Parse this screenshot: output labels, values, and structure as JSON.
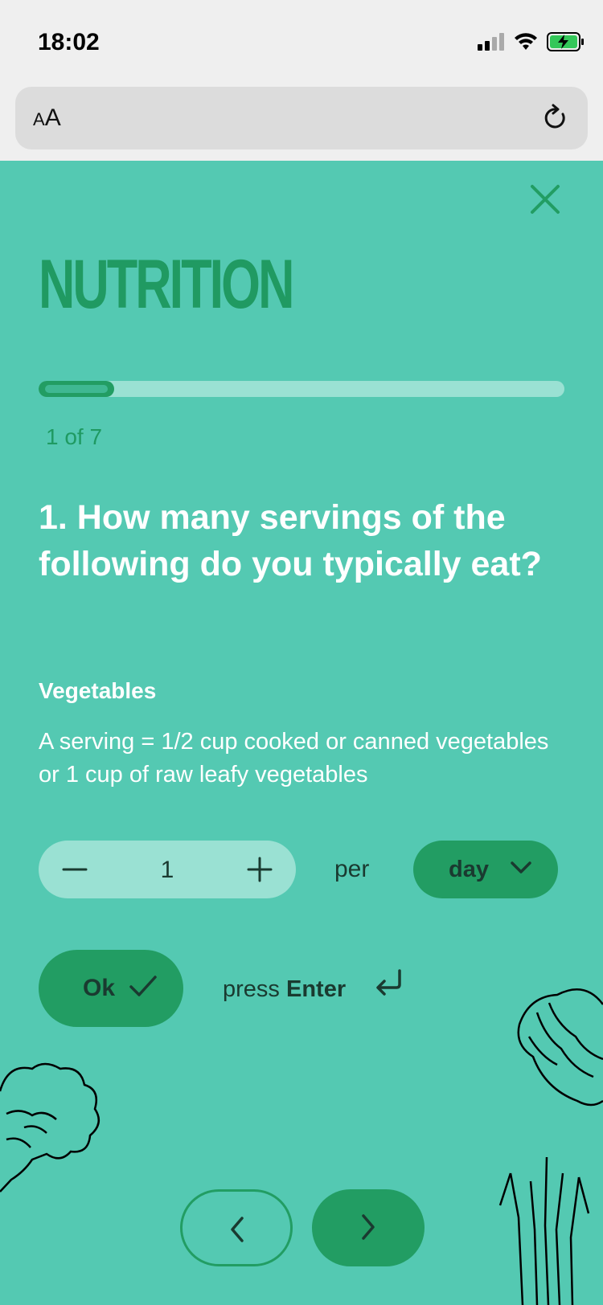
{
  "status_bar": {
    "time": "18:02"
  },
  "browser": {
    "text_size_small": "A",
    "text_size_large": "A"
  },
  "quiz": {
    "section_title": "NUTRITION",
    "progress": {
      "current": 1,
      "total": 7,
      "fraction": 0.143,
      "label": "1 of 7"
    },
    "question": "1. How many servings of the following do you typically eat?",
    "item_name": "Vegetables",
    "item_description": "A serving = 1/2 cup cooked or canned vegetables or 1 cup of raw leafy vegetables",
    "quantity": "1",
    "per_label": "per",
    "period_selected": "day",
    "ok_label": "Ok",
    "hint_prefix": "press",
    "hint_key": "Enter"
  },
  "icons": [
    "close-icon",
    "minus-icon",
    "plus-icon",
    "chevron-down-icon",
    "check-icon",
    "enter-key-icon",
    "chevron-left-icon",
    "chevron-right-icon",
    "reload-icon"
  ],
  "colors": {
    "background": "#54c9b2",
    "accent": "#229d63",
    "light": "#9ae1d3",
    "text": "#ffffff"
  }
}
